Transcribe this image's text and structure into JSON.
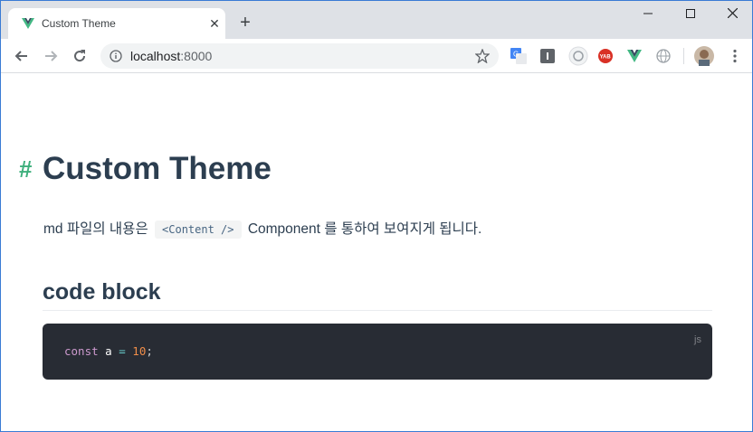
{
  "browser": {
    "tab_title": "Custom Theme",
    "tab_close": "✕",
    "new_tab": "+",
    "url_host": "localhost",
    "url_port": ":8000",
    "window_minimize": "—",
    "window_maximize": "☐",
    "window_close": "✕",
    "extensions": [
      "google-translate-icon",
      "instapaper-icon",
      "extension-gear-icon",
      "yab-icon",
      "vue-devtools-icon",
      "globe-icon"
    ],
    "colors": {
      "tabstrip": "#dee1e6",
      "vue_green": "#42b883"
    }
  },
  "page": {
    "heading_anchor": "#",
    "heading": "Custom Theme",
    "paragraph_before": "md 파일의 내용은",
    "paragraph_code": "<Content />",
    "paragraph_after": "Component 를 통하여 보여지게 됩니다.",
    "subheading": "code block",
    "code_lang": "js",
    "code": {
      "keyword": "const",
      "identifier": "a",
      "operator": "=",
      "number": "10",
      "punct": ";"
    },
    "colors": {
      "accent": "#3eaf7c",
      "text": "#2c3e50",
      "code_bg": "#282c34"
    }
  }
}
